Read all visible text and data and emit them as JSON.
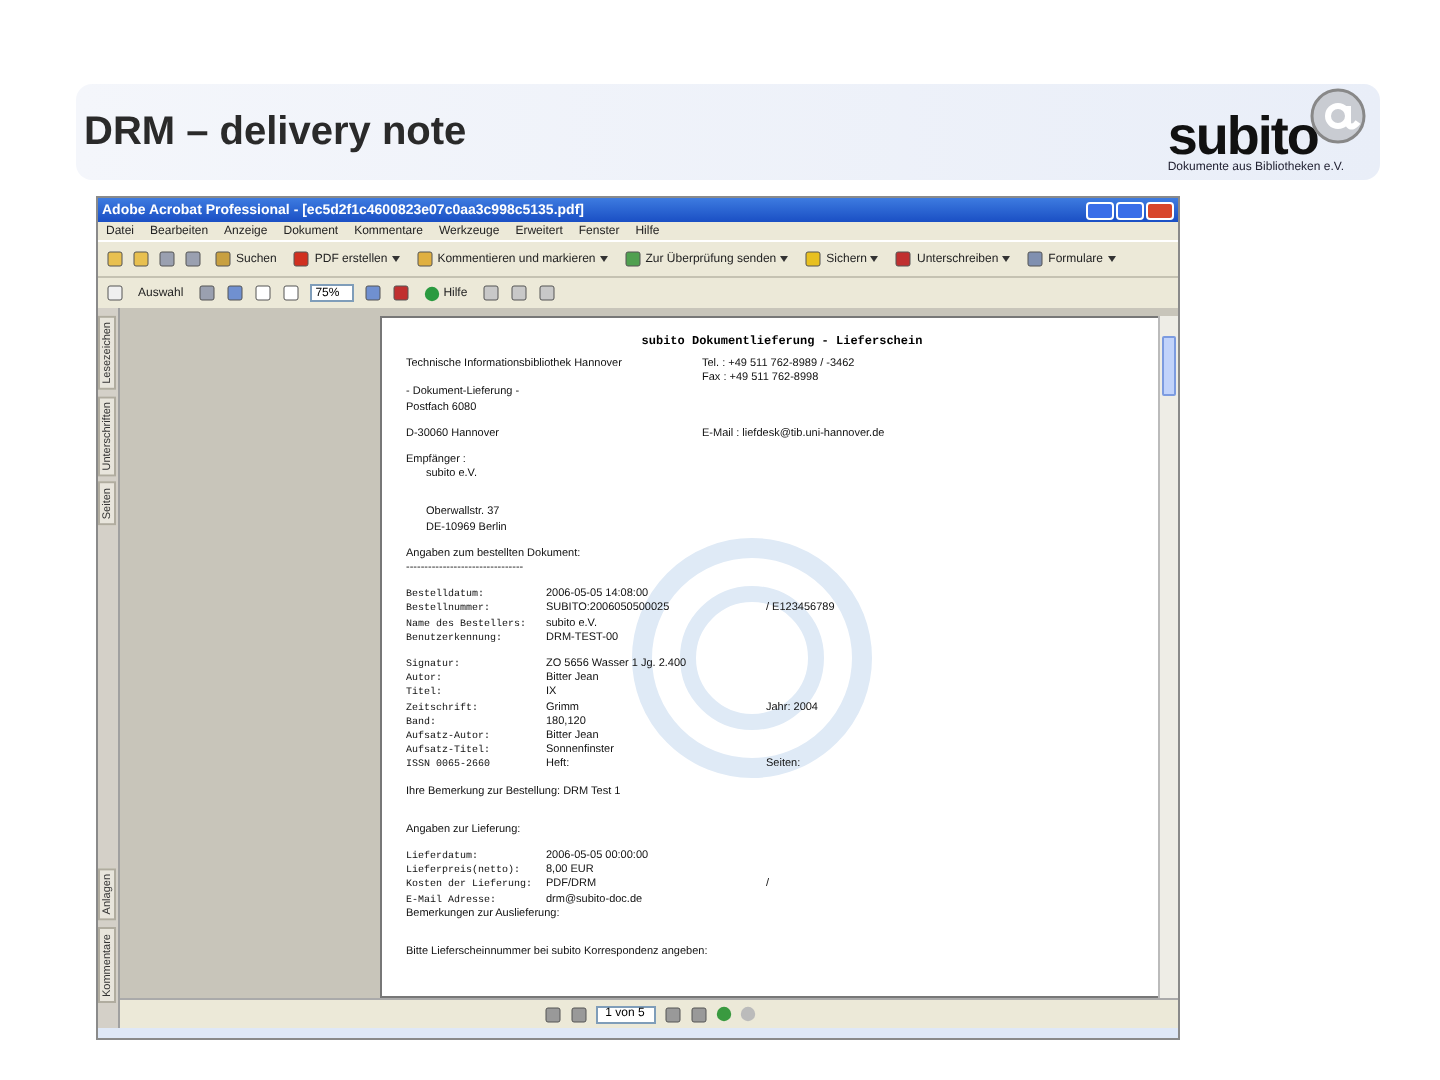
{
  "slide": {
    "title": "DRM – delivery note",
    "logo": {
      "wordmark": "subito",
      "tagline": "Dokumente aus Bibliotheken e.V."
    }
  },
  "window": {
    "title": "Adobe Acrobat Professional - [ec5d2f1c4600823e07c0aa3c998c5135.pdf]"
  },
  "menu": [
    "Datei",
    "Bearbeiten",
    "Anzeige",
    "Dokument",
    "Kommentare",
    "Werkzeuge",
    "Erweitert",
    "Fenster",
    "Hilfe"
  ],
  "toolbar": [
    {
      "label": "Suchen",
      "dropdown": false
    },
    {
      "label": "PDF erstellen",
      "dropdown": true
    },
    {
      "label": "Kommentieren und markieren",
      "dropdown": true
    },
    {
      "label": "Zur Überprüfung senden",
      "dropdown": true
    },
    {
      "label": "Sichern",
      "dropdown": true
    },
    {
      "label": "Unterschreiben",
      "dropdown": true
    },
    {
      "label": "Formulare",
      "dropdown": true
    }
  ],
  "toolbar2": {
    "select_label": "Auswahl",
    "zoom": "75%",
    "help_label": "Hilfe"
  },
  "side_tabs": [
    {
      "label": "Lesezeichen",
      "selected": false
    },
    {
      "label": "Unterschriften",
      "selected": false
    },
    {
      "label": "Seiten",
      "selected": false
    },
    {
      "label": "Anlagen",
      "selected": false
    },
    {
      "label": "Kommentare",
      "selected": false
    }
  ],
  "document": {
    "heading": "subito Dokumentlieferung - Lieferschein",
    "rows": [
      {
        "kind": "split",
        "left": "Technische Informationsbibliothek Hannover",
        "right": "Tel. : +49 511 762-8989 / -3462"
      },
      {
        "kind": "split",
        "left": "",
        "right": "Fax : +49 511 762-8998"
      },
      {
        "kind": "line",
        "text": "- Dokument-Lieferung -"
      },
      {
        "kind": "line",
        "text": "Postfach 6080"
      },
      {
        "kind": "gap"
      },
      {
        "kind": "split",
        "left": "D-30060 Hannover",
        "right": "E-Mail : liefdesk@tib.uni-hannover.de"
      },
      {
        "kind": "gap"
      },
      {
        "kind": "line",
        "text": "Empfänger :"
      },
      {
        "kind": "indent",
        "text": "subito e.V."
      },
      {
        "kind": "gap"
      },
      {
        "kind": "gap"
      },
      {
        "kind": "indent",
        "text": "Oberwallstr. 37"
      },
      {
        "kind": "indent",
        "text": "DE-10969 Berlin"
      },
      {
        "kind": "gap"
      },
      {
        "kind": "line",
        "text": "Angaben zum bestellten Dokument:"
      },
      {
        "kind": "line",
        "text": "--------------------------------"
      },
      {
        "kind": "gap"
      },
      {
        "kind": "field",
        "label": "Bestelldatum:",
        "value": "2006-05-05 14:08:00",
        "note": ""
      },
      {
        "kind": "field",
        "label": "Bestellnummer:",
        "value": "SUBITO:2006050500025",
        "note": "/ E123456789"
      },
      {
        "kind": "field",
        "label": "Name des Bestellers:",
        "value": "subito e.V.",
        "note": ""
      },
      {
        "kind": "field",
        "label": "Benutzerkennung:",
        "value": "DRM-TEST-00",
        "note": ""
      },
      {
        "kind": "gap"
      },
      {
        "kind": "field",
        "label": "Signatur:",
        "value": "ZO 5656 Wasser 1 Jg. 2.400",
        "note": ""
      },
      {
        "kind": "field",
        "label": "Autor:",
        "value": "Bitter Jean",
        "note": ""
      },
      {
        "kind": "field",
        "label": "Titel:",
        "value": "IX",
        "note": ""
      },
      {
        "kind": "field",
        "label": "Zeitschrift:",
        "value": "Grimm",
        "note": "Jahr: 2004"
      },
      {
        "kind": "field",
        "label": "Band:",
        "value": "180,120",
        "note": ""
      },
      {
        "kind": "field",
        "label": "Aufsatz-Autor:",
        "value": "Bitter Jean",
        "note": ""
      },
      {
        "kind": "field",
        "label": "Aufsatz-Titel:",
        "value": "Sonnenfinster",
        "note": ""
      },
      {
        "kind": "field",
        "label": "ISSN 0065-2660",
        "value": "Heft:",
        "note": "Seiten:"
      },
      {
        "kind": "gap"
      },
      {
        "kind": "line",
        "text": "Ihre Bemerkung zur Bestellung: DRM Test 1"
      },
      {
        "kind": "gap"
      },
      {
        "kind": "gap"
      },
      {
        "kind": "line",
        "text": "Angaben zur Lieferung:"
      },
      {
        "kind": "gap"
      },
      {
        "kind": "field",
        "label": "Lieferdatum:",
        "value": "2006-05-05 00:00:00",
        "note": ""
      },
      {
        "kind": "field",
        "label": "Lieferpreis(netto):",
        "value": "8,00 EUR",
        "note": ""
      },
      {
        "kind": "field",
        "label": "Kosten der Lieferung:",
        "value": "PDF/DRM",
        "note": "/"
      },
      {
        "kind": "field",
        "label": "E-Mail Adresse:",
        "value": "drm@subito-doc.de",
        "note": ""
      },
      {
        "kind": "line",
        "text": "Bemerkungen zur Auslieferung:"
      },
      {
        "kind": "gap"
      },
      {
        "kind": "gap"
      },
      {
        "kind": "line",
        "text": "Bitte Lieferscheinnummer bei subito Korrespondenz angeben:"
      }
    ]
  },
  "pager": {
    "page": "1 von 5"
  }
}
